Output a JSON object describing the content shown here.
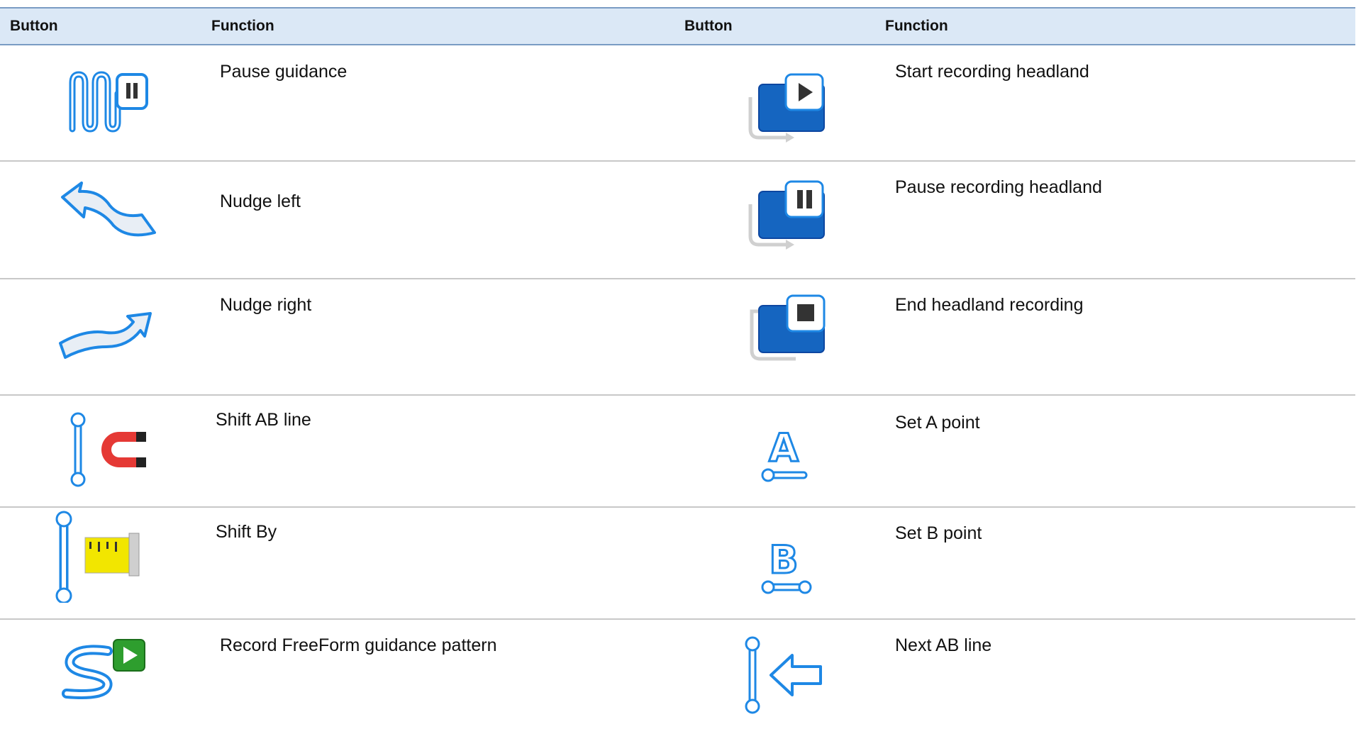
{
  "header": {
    "col1": "Button",
    "col2": "Function",
    "col3": "Button",
    "col4": "Function"
  },
  "rows": [
    {
      "left": {
        "icon": "pause-guidance-icon",
        "function": "Pause guidance"
      },
      "right": {
        "icon": "start-recording-headland-icon",
        "function": "Start recording headland"
      }
    },
    {
      "left": {
        "icon": "nudge-left-icon",
        "function": "Nudge left"
      },
      "right": {
        "icon": "pause-recording-headland-icon",
        "function": "Pause recording headland"
      }
    },
    {
      "left": {
        "icon": "nudge-right-icon",
        "function": "Nudge right"
      },
      "right": {
        "icon": "end-headland-recording-icon",
        "function": "End headland recording"
      }
    },
    {
      "left": {
        "icon": "shift-ab-line-icon",
        "function": "Shift AB line"
      },
      "right": {
        "icon": "set-a-point-icon",
        "function": "Set A point"
      }
    },
    {
      "left": {
        "icon": "shift-by-icon",
        "function": "Shift By"
      },
      "right": {
        "icon": "set-b-point-icon",
        "function": "Set B point"
      }
    },
    {
      "left": {
        "icon": "record-freeform-icon",
        "function": "Record FreeForm guidance pattern"
      },
      "right": {
        "icon": "next-ab-line-icon",
        "function": "Next AB line"
      }
    }
  ],
  "colors": {
    "header_bg": "#dbe8f6",
    "header_border": "#7a9cc4",
    "row_border": "#c8c8c8",
    "icon_blue": "#1565c0",
    "icon_outline": "#1e88e5",
    "magnet_red": "#e53935",
    "tape_yellow": "#f2e600",
    "play_green": "#2e9e2e"
  }
}
